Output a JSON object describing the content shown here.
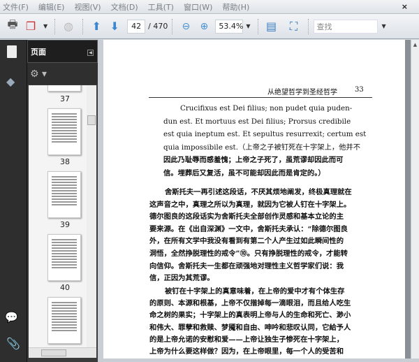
{
  "menu": [
    "文件(F)",
    "编辑(E)",
    "视图(V)",
    "文档(D)",
    "工具(T)",
    "窗口(W)",
    "帮助(H)"
  ],
  "menu_close": "×",
  "toolbar": {
    "page_current": "42",
    "page_total": "/ 470",
    "zoom": "53.4%",
    "search_placeholder": "查找"
  },
  "panel": {
    "title": "页面",
    "thumbnails": [
      {
        "label": "37"
      },
      {
        "label": "38"
      },
      {
        "label": "39"
      },
      {
        "label": "40"
      }
    ]
  },
  "document": {
    "running_header": "从绝望哲学到圣经哲学",
    "page_number": "33",
    "latin_lines": [
      "Crucifixus est Dei filius; non pudet quia puden-",
      "dun est. Et mortuus est Dei filius; Prorsus credibile",
      "est quia ineptum est. Et sepultus resurrexit; certum est",
      "quia impossibile est.（上帝之子被钉死在十字架上，他并不",
      "因此乃耻辱而感羞愧；上帝之子死了，虽荒谬却因此而可",
      "信。埋葬后又复活，虽不可能却因此而是肯定的。）"
    ],
    "para1": [
      "舍斯托夫一再引述这段话，不厌其烦地阐发，终极真理就在",
      "这声音之中，真理之所以为真理，就因为它被人钉在十字架上。",
      "德尔图良的这段话实为舍斯托夫全部创作灵感和基本立论的主",
      "要来源。在《出自深渊》一文中，舍斯托夫承认：“除德尔图良",
      "外，在所有文学中我没有看到有第二个人产生过如此瞬间性的",
      "洞悟，全然挣脱理性的戒令”⑩。只有挣脱理性的戒令，才能转",
      "向信仰。舍斯托夫一生都在顽强地对理性主义哲学家们说：我",
      "信，正因为其荒谬。"
    ],
    "para2": [
      "被钉在十字架上的真意味着，在上帝的爱中才有个体生存",
      "的原则、本源和根基，上帝不仅揩掉每一滴眼泪，而且给人吃生",
      "命之树的果实；十字架上的真表明上帝与人的生命和死亡、渺小",
      "和伟大、罪孽和救赎、梦魇和自由、呻吟和悲叹认同，它給予人",
      "的是上帝允诺的安慰和爱——上帝让独生子惨死在十字架上，",
      "上帝为什么要这样做？因为，在上帝眼里，每一个人的受苦和"
    ]
  }
}
